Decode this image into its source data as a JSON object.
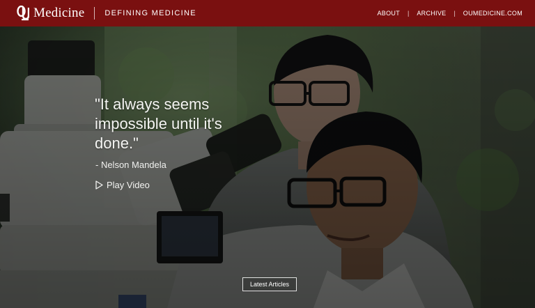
{
  "header": {
    "logo_icon": "ou-logo-icon",
    "brand_name": "Medicine",
    "tagline": "DEFINING MEDICINE",
    "background": "#7a1010",
    "nav": [
      {
        "label": "ABOUT"
      },
      {
        "label": "ARCHIVE"
      },
      {
        "label": "OUMEDICINE.COM"
      }
    ],
    "nav_separator": "|"
  },
  "hero": {
    "quote": "\"It always seems impossible until it's done.\"",
    "author": "- Nelson Mandela",
    "play_icon": "play-icon",
    "play_label": "Play Video",
    "latest_label": "Latest Articles"
  }
}
